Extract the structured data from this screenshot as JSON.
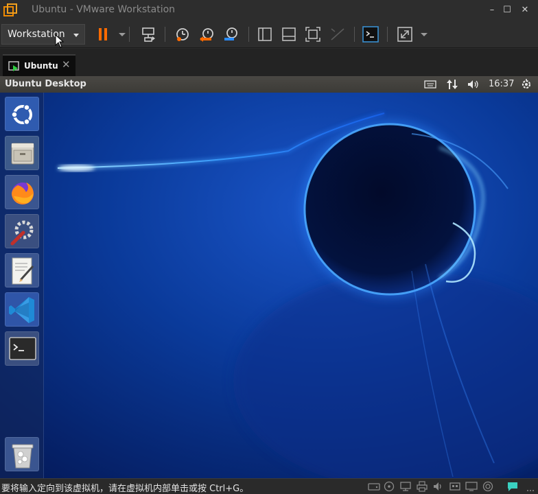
{
  "window": {
    "title": "Ubuntu - VMware Workstation",
    "minimize": "–",
    "maximize": "☐",
    "close": "✕"
  },
  "toolbar": {
    "menu_label": "Workstation",
    "buttons": [
      "pause-icon",
      "pause-dropdown-icon",
      "send-ctrl-alt-del-icon",
      "snapshot-icon",
      "revert-snapshot-icon",
      "snapshot-manager-icon",
      "library-icon",
      "thumbnail-bar-icon",
      "full-screen-icon",
      "unity-icon",
      "console-view-icon",
      "stretch-guest-icon"
    ]
  },
  "tab": {
    "label": "Ubuntu",
    "close": "✕"
  },
  "guest": {
    "panel_title": "Ubuntu Desktop",
    "clock": "16:37",
    "launcher_apps": [
      "ubuntu-dash-icon",
      "files-icon",
      "firefox-icon",
      "system-settings-icon",
      "text-editor-icon",
      "vscode-icon",
      "terminal-icon",
      "trash-icon"
    ]
  },
  "status": {
    "message": "要将输入定向到该虚拟机，请在虚拟机内部单击或按 Ctrl+G。",
    "devices": [
      "hard-disk-icon",
      "cd-dvd-icon",
      "network-icon",
      "usb-icon",
      "printer-icon",
      "sound-icon",
      "display-icon",
      "message-icon"
    ]
  },
  "colors": {
    "accent_orange": "#ff6a00",
    "desktop_blue": "#0a3a9a",
    "glow_blue": "#3aa0ff"
  }
}
